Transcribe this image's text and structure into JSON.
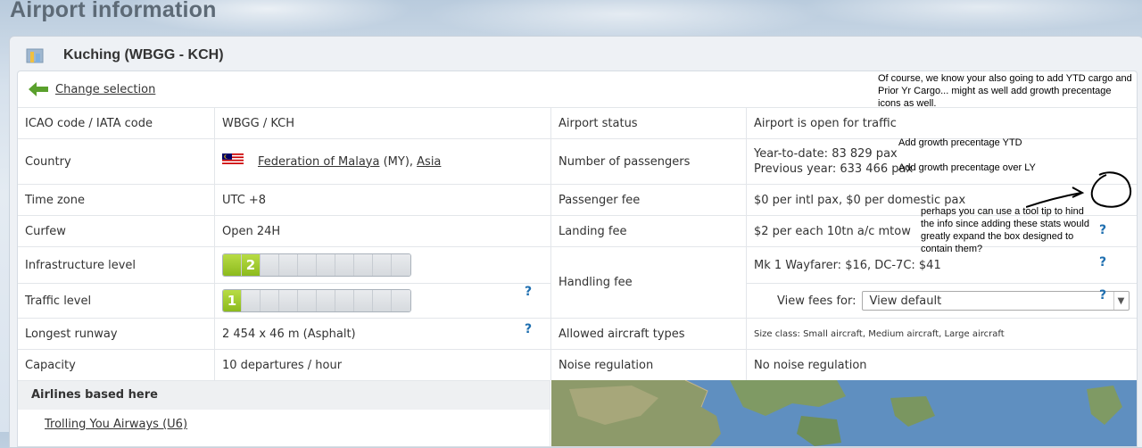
{
  "page": {
    "title": "Airport information"
  },
  "airport": {
    "name": "Kuching (WBGG - KCH)"
  },
  "change_selection": "Change selection",
  "rows": {
    "icao_label": "ICAO code / IATA code",
    "icao_value": "WBGG / KCH",
    "country_label": "Country",
    "country_name": "Federation of Malaya",
    "country_code": " (MY), ",
    "continent": "Asia",
    "timezone_label": "Time zone",
    "timezone_value": "UTC +8",
    "curfew_label": "Curfew",
    "curfew_value": "Open 24H",
    "infra_label": "Infrastructure level",
    "infra_level": 2,
    "infra_text": "2",
    "infra_max": 10,
    "traffic_label": "Traffic level",
    "traffic_level": 1,
    "traffic_text": "1",
    "traffic_max": 10,
    "runway_label": "Longest runway",
    "runway_value": "2 454 x 46 m (Asphalt)",
    "capacity_label": "Capacity",
    "capacity_value": "10 departures / hour",
    "status_label": "Airport status",
    "status_value": "Airport is open for traffic",
    "passengers_label": "Number of passengers",
    "passengers_ytd": "Year-to-date: 83 829 pax",
    "passengers_prev": "Previous year: 633 466 pax",
    "pax_fee_label": "Passenger fee",
    "pax_fee_value": "$0 per intl pax, $0 per domestic pax",
    "landing_fee_label": "Landing fee",
    "landing_fee_value": "$2 per each 10tn a/c mtow",
    "handling_fee_label": "Handling fee",
    "handling_fee_value": "Mk 1 Wayfarer: $16,   DC-7C: $41",
    "view_fees_label": "View fees for:",
    "view_fees_selected": "View default",
    "aircraft_label": "Allowed aircraft types",
    "aircraft_value": "Size class: Small aircraft, Medium aircraft, Large aircraft",
    "noise_label": "Noise regulation",
    "noise_value": "No noise regulation",
    "help_mark": "?"
  },
  "airlines": {
    "heading": "Airlines based here",
    "items": [
      "Trolling You Airways (U6)"
    ]
  },
  "annotations": {
    "note_top": "Of course, we know your also going to add YTD cargo and Prior Yr Cargo... might as well add growth precentage icons as well.",
    "note_ytd": "Add growth precentage YTD",
    "note_ly": "Add growth precentage over LY",
    "note_tooltip": "perhaps you can use a tool tip to hind the info since adding these stats would greatly expand the box designed to contain them?"
  },
  "colors": {
    "accent_link": "#1f6fb0",
    "level_on": "#9cc62b",
    "back_arrow": "#5aa02c"
  }
}
